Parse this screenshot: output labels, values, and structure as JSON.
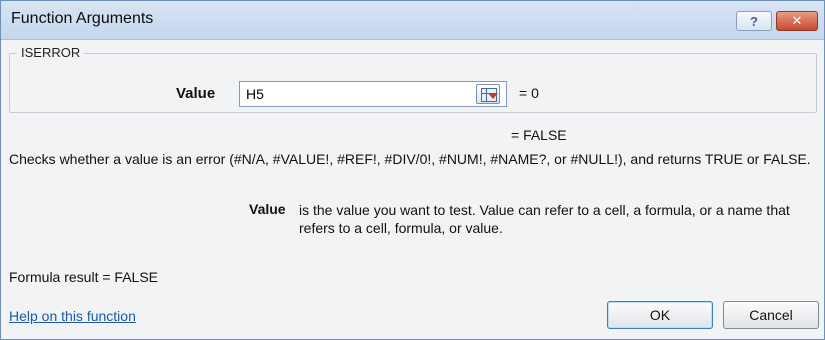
{
  "window": {
    "title": "Function Arguments",
    "help_glyph": "?",
    "close_glyph": "✕"
  },
  "function": {
    "name": "ISERROR",
    "arguments": [
      {
        "name": "Value",
        "input_value": "H5",
        "evaluated": "= 0"
      }
    ],
    "result_preview": "= FALSE",
    "description": "Checks whether a value is an error (#N/A, #VALUE!, #REF!, #DIV/0!, #NUM!, #NAME?, or #NULL!), and returns TRUE or FALSE.",
    "parameter_help": {
      "name": "Value",
      "text": "is the value you want to test. Value can refer to a cell, a formula, or a name that refers to a cell, formula, or value."
    }
  },
  "footer": {
    "formula_result": "Formula result =  FALSE",
    "help_link": "Help on this function",
    "ok_label": "OK",
    "cancel_label": "Cancel"
  },
  "icons": {
    "help": "help-icon",
    "close": "close-icon",
    "collapse_dialog": "collapse-dialog-icon"
  },
  "colors": {
    "titlebar": "#c5d7ee",
    "close_button": "#c9492f",
    "link": "#1c5aa6"
  }
}
